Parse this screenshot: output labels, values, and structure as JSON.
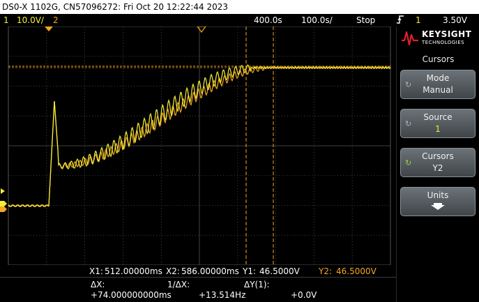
{
  "title_bar": {
    "text": "DS0-X 1102G, CN57096272: Fri Oct 20 12:22:44 2023"
  },
  "status_bar": {
    "ch1_number": "1",
    "ch1_scale": "10.0V/",
    "ch2_number": "2",
    "timebase_pos": "400.0s",
    "timebase_scale": "100.0s/",
    "run_state": "Stop",
    "trigger_icon": "trigger-edge-icon",
    "trigger_source": "1",
    "trigger_level": "3.50V"
  },
  "colors": {
    "ch1": "#f2ef36",
    "ch2": "#f5a623",
    "grid": "#555555",
    "screen_bg": "#000000",
    "panel_bg": "#000000",
    "active_knob": "#9ad43a"
  },
  "panel": {
    "brand": "KEYSIGHT",
    "brand_sub": "TECHNOLOGIES",
    "title": "Cursors",
    "softkeys": [
      {
        "label": "Mode",
        "value": "Manual",
        "icon": "knob-icon"
      },
      {
        "label": "Source",
        "value": "1",
        "icon": "knob-icon"
      },
      {
        "label": "Cursors",
        "value": "Y2",
        "icon": "knob-active-icon"
      },
      {
        "label": "Units",
        "value": "",
        "icon": "arrow-down-icon"
      }
    ]
  },
  "readout": {
    "x1_label": "X1:",
    "x1_value": "512.00000ms",
    "x2_label": "X2:",
    "x2_value": "586.00000ms",
    "y1_label": "Y1:",
    "y1_value": "46.5000V",
    "y2_label": "Y2:",
    "y2_value": "46.5000V",
    "dx_label": "ΔX:",
    "dx_value": "+74.000000000ms",
    "inv_dx_label": "1/ΔX:",
    "inv_dx_value": "+13.514Hz",
    "dy_label": "ΔY(1):",
    "dy_value": "+0.0V"
  }
}
